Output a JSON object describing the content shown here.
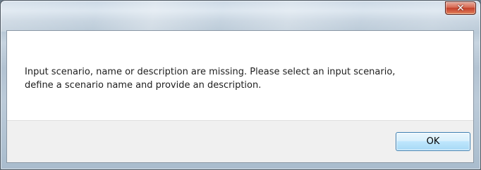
{
  "dialog": {
    "close_glyph": "✕",
    "message": "Input scenario, name or description are missing. Please select an input scenario,\ndefine a scenario name and provide an description.",
    "ok_label": "OK"
  },
  "icons": {
    "close": "close-icon"
  },
  "colors": {
    "close_button": "#c4412a",
    "ok_border": "#3c7fb1",
    "footer_bg": "#f0f0f0"
  }
}
